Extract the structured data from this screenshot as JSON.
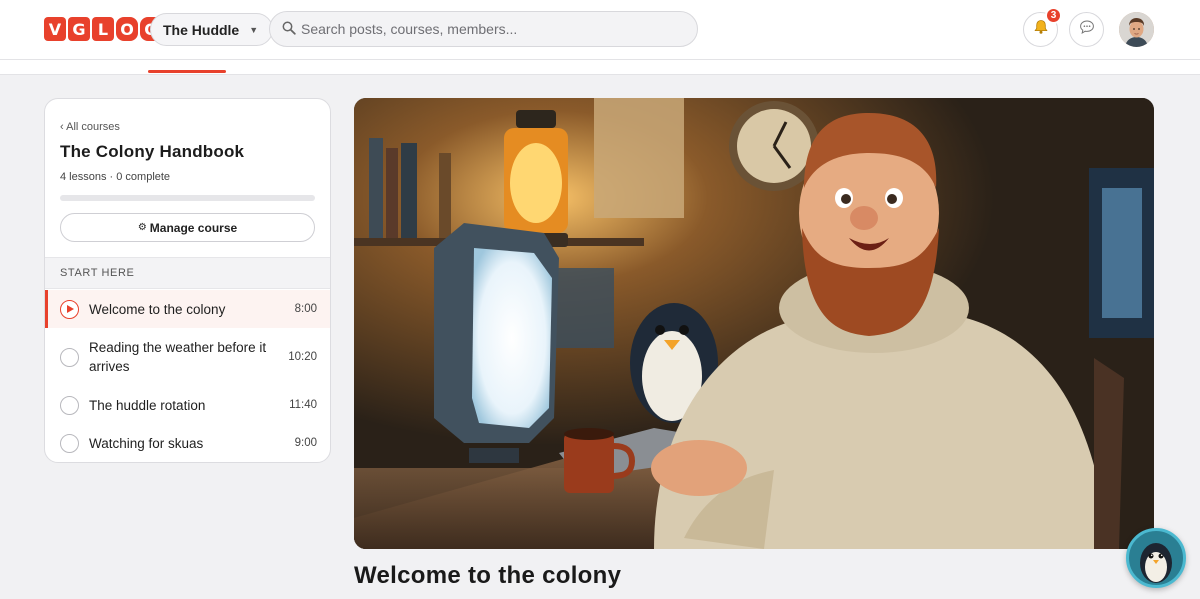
{
  "header": {
    "logo_letters": [
      "V",
      "G",
      "L",
      "O",
      "O"
    ],
    "community_name": "The Huddle",
    "search_placeholder": "Search posts, courses, members...",
    "notifications_count": "3",
    "icons": {
      "search": "magnifier-icon",
      "notifications": "bell-icon",
      "messages": "chat-bubble-icon",
      "community_caret": "caret-down-icon"
    }
  },
  "course": {
    "back_label": "‹ All courses",
    "title": "The Colony Handbook",
    "progress_text": "4 lessons · 0 complete",
    "progress_fraction": 0,
    "manage_label": "Manage course",
    "section_label": "START HERE",
    "lessons": [
      {
        "title": "Welcome to the colony",
        "duration": "8:00",
        "active": true
      },
      {
        "title": "Reading the weather before it arrives",
        "duration": "10:20",
        "active": false
      },
      {
        "title": "The huddle rotation",
        "duration": "11:40",
        "active": false
      },
      {
        "title": "Watching for skuas",
        "duration": "9:00",
        "active": false
      }
    ]
  },
  "main": {
    "lesson_heading": "Welcome to the colony"
  },
  "colors": {
    "accent": "#e8412c",
    "background": "#f1f1f3"
  }
}
